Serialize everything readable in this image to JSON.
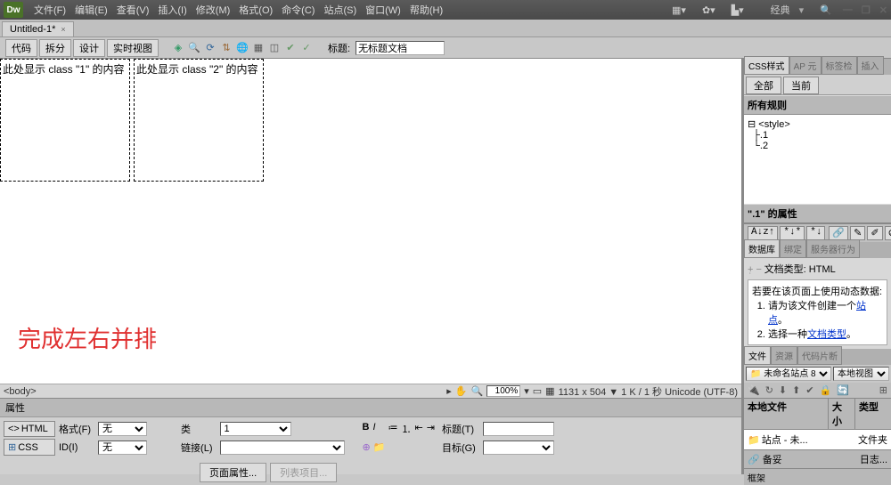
{
  "title_bar": {
    "logo": "Dw",
    "menus": [
      "文件(F)",
      "编辑(E)",
      "查看(V)",
      "插入(I)",
      "修改(M)",
      "格式(O)",
      "命令(C)",
      "站点(S)",
      "窗口(W)",
      "帮助(H)"
    ],
    "layout_label": "经典",
    "min": "—",
    "max": "❐",
    "close": "✕"
  },
  "doc_tab": {
    "name": "Untitled-1*",
    "close": "×"
  },
  "toolbar": {
    "code": "代码",
    "split": "拆分",
    "design": "设计",
    "live": "实时视图",
    "title_label": "标题:",
    "title_value": "无标题文档"
  },
  "canvas": {
    "box1_text": "此处显示 class \"1\" 的内容",
    "box2_text": "此处显示 class \"2\" 的内容",
    "annotation": "完成左右并排"
  },
  "status": {
    "tag": "<body>",
    "zoom": "100%",
    "info": "1131 x 504 ▼ 1 K / 1 秒 Unicode (UTF-8)"
  },
  "props": {
    "header": "属性",
    "html_btn": "HTML",
    "css_btn": "CSS",
    "format_label": "格式(F)",
    "format_val": "无",
    "class_label": "类",
    "class_val": "1",
    "id_label": "ID(I)",
    "id_val": "无",
    "link_label": "链接(L)",
    "link_val": "",
    "title2_label": "标题(T)",
    "target_label": "目标(G)",
    "page_props": "页面属性...",
    "list_item": "列表项目..."
  },
  "right": {
    "css_tab": "CSS样式",
    "ap_tab": "AP 元",
    "tag_tab": "标签检",
    "insert_tab": "插入",
    "all": "全部",
    "current": "当前",
    "rules_head": "所有规则",
    "rules": [
      "⊟ <style>",
      "  ├.1",
      "  └.2"
    ],
    "prop_head": "\".1\" 的属性",
    "btns": {
      "az": "A↓z↑",
      "star1": "*↓*",
      "star2": "*↓"
    },
    "db_tab": "数据库",
    "bind_tab": "绑定",
    "server_tab": "服务器行为",
    "doc_type": "文档类型: HTML",
    "hint_head": "若要在该页面上使用动态数据:",
    "hint1_a": "请为该文件创建一个",
    "hint1_b": "站点",
    "hint1_c": "。",
    "hint2_a": "选择一种",
    "hint2_b": "文档类型",
    "hint2_c": "。",
    "files_tab": "文件",
    "assets_tab": "资源",
    "snippets_tab": "代码片断",
    "site_select": "未命名站点 8",
    "view_select": "本地视图",
    "col_local": "本地文件",
    "col_size": "大小",
    "col_type": "类型",
    "file_name": "站点 - 未...",
    "file_type": "文件夹",
    "ready": "备妥",
    "log": "日志...",
    "frames": "框架"
  }
}
